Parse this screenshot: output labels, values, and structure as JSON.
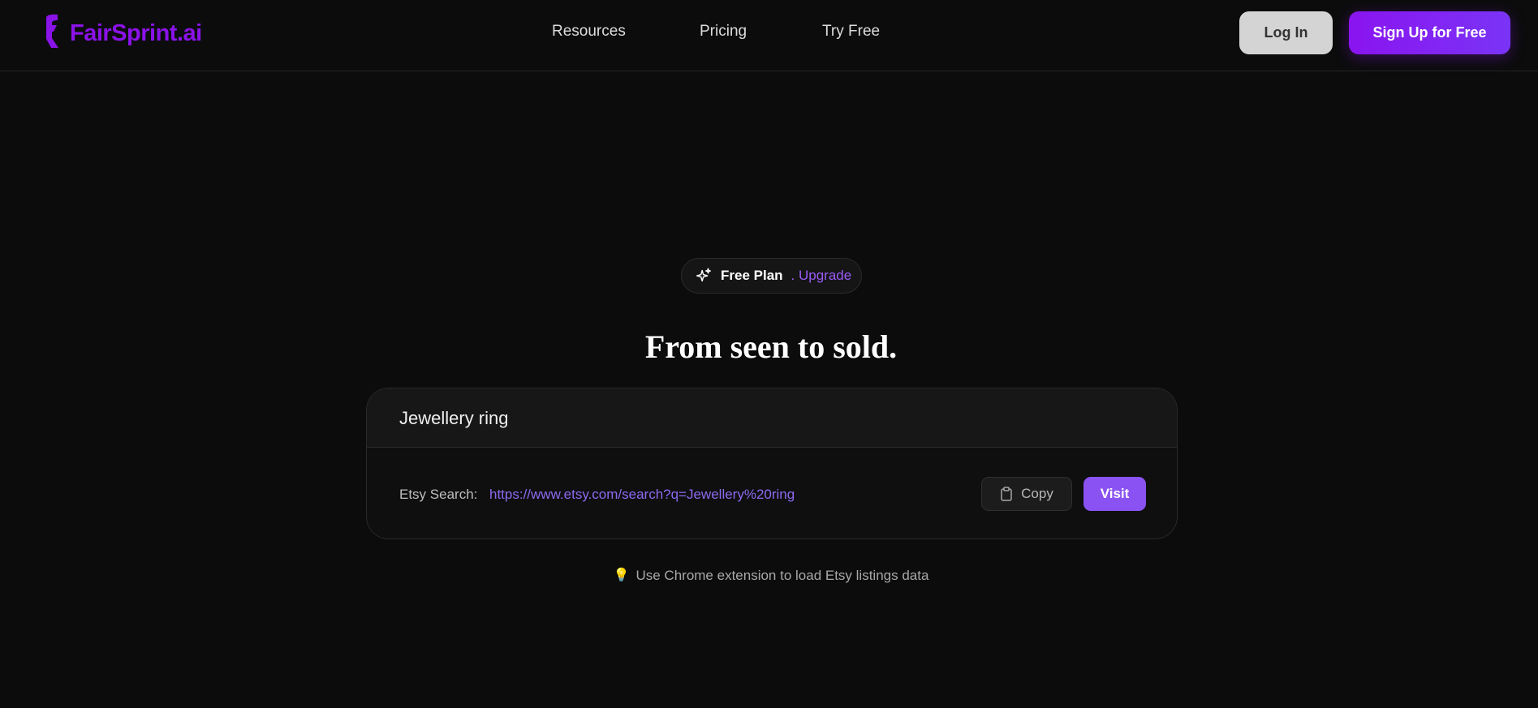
{
  "colors": {
    "background": "#0c0c0c",
    "brand": "#8a13e8",
    "accent": "#8a52f2",
    "link": "#8c6af0"
  },
  "header": {
    "logo_text": "FairSprint.ai",
    "logo_icon": "fairsprint-logo-icon",
    "nav": [
      {
        "label": "Resources"
      },
      {
        "label": "Pricing"
      },
      {
        "label": "Try Free"
      }
    ],
    "login_label": "Log In",
    "signup_label": "Sign Up for Free"
  },
  "plan": {
    "icon": "sparkle-icon",
    "label": "Free Plan",
    "upgrade_label": ". Upgrade"
  },
  "headline": "From seen to sold.",
  "search_card": {
    "query_value": "Jewellery ring",
    "result_label": "Etsy Search:",
    "result_url": "https://www.etsy.com/search?q=Jewellery%20ring",
    "copy_icon": "clipboard-icon",
    "copy_label": "Copy",
    "visit_label": "Visit"
  },
  "hint": {
    "icon": "lightbulb-icon",
    "text": "Use Chrome extension to load Etsy listings data"
  }
}
